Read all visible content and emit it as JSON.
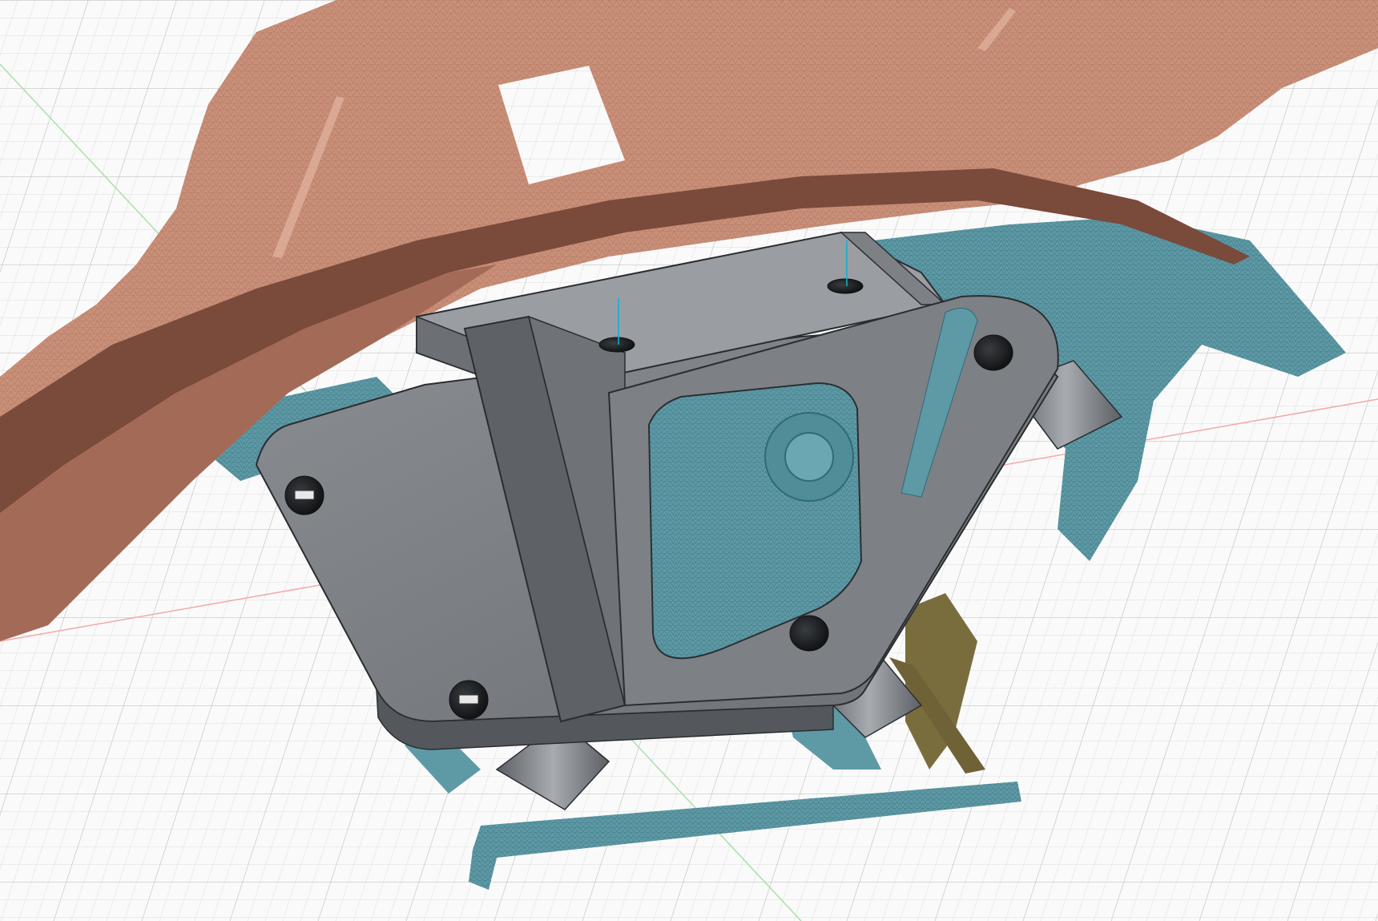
{
  "viewport": {
    "title": "",
    "background_color": "#fafafa",
    "grid": {
      "visible": true,
      "minor_color": "#dcdcdc",
      "major_color": "#c2c2c2"
    },
    "axes": {
      "x_color": "#f2a9a9",
      "y_color": "#a9e0a9",
      "z_color": "#00b7d6"
    }
  },
  "bodies": {
    "scan_mesh_body": {
      "color": "#c98f78",
      "dark_color": "#7a4a3a",
      "wire_color": "#8f5d4b"
    },
    "scan_mesh_fragments": {
      "color": "#5e9aa6",
      "dark_color": "#2f6a78",
      "wire_color": "#3e7f8c"
    },
    "rust_fragments": {
      "color": "#7a6d3d"
    },
    "bracket": {
      "color": "#7d8186",
      "light_color": "#9a9ea3",
      "dark_color": "#54585d",
      "edge_color": "#2a2d30"
    }
  },
  "fasteners": [
    {
      "name": "bolt-hole-top-left"
    },
    {
      "name": "bolt-hole-top-right"
    },
    {
      "name": "bolt-hole-right-upper"
    },
    {
      "name": "bolt-hole-right-lower"
    },
    {
      "name": "bolt-hole-left-upper"
    },
    {
      "name": "bolt-hole-left-lower"
    }
  ]
}
